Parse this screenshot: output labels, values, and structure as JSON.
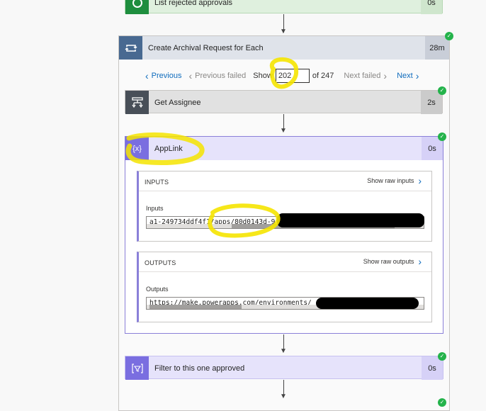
{
  "steps": {
    "list_rejected": {
      "title": "List rejected approvals",
      "duration": "0s"
    },
    "loop": {
      "title": "Create Archival Request for Each",
      "duration": "28m"
    },
    "get_assignee": {
      "title": "Get Assignee",
      "duration": "2s"
    },
    "applink": {
      "title": "AppLink",
      "duration": "0s"
    },
    "filter": {
      "title": "Filter to this one approved",
      "duration": "0s"
    }
  },
  "pager": {
    "previous": "Previous",
    "previous_failed": "Previous failed",
    "show_label": "Show",
    "current": "202",
    "of_total": "of 247",
    "next_failed": "Next failed",
    "next": "Next"
  },
  "inputs": {
    "section_title": "INPUTS",
    "raw_link": "Show raw inputs",
    "field_label": "Inputs",
    "value": "a1-249734ddf4f1/apps/80d0143d-9"
  },
  "outputs": {
    "section_title": "OUTPUTS",
    "raw_link": "Show raw outputs",
    "field_label": "Outputs",
    "value": "https://make.powerapps.com/environments/"
  },
  "colors": {
    "success": "#24b34b",
    "loop_header": "#dfe3ea",
    "applink_header": "#e6e3fb",
    "variable_icon": "#7a6ee0",
    "highlight": "#f5e400",
    "link": "#0f6cbd"
  },
  "icons": {
    "list": "approvals-icon",
    "loop": "loop-icon",
    "assignee": "assignee-icon",
    "variable": "variable-icon",
    "filter": "filter-icon"
  }
}
